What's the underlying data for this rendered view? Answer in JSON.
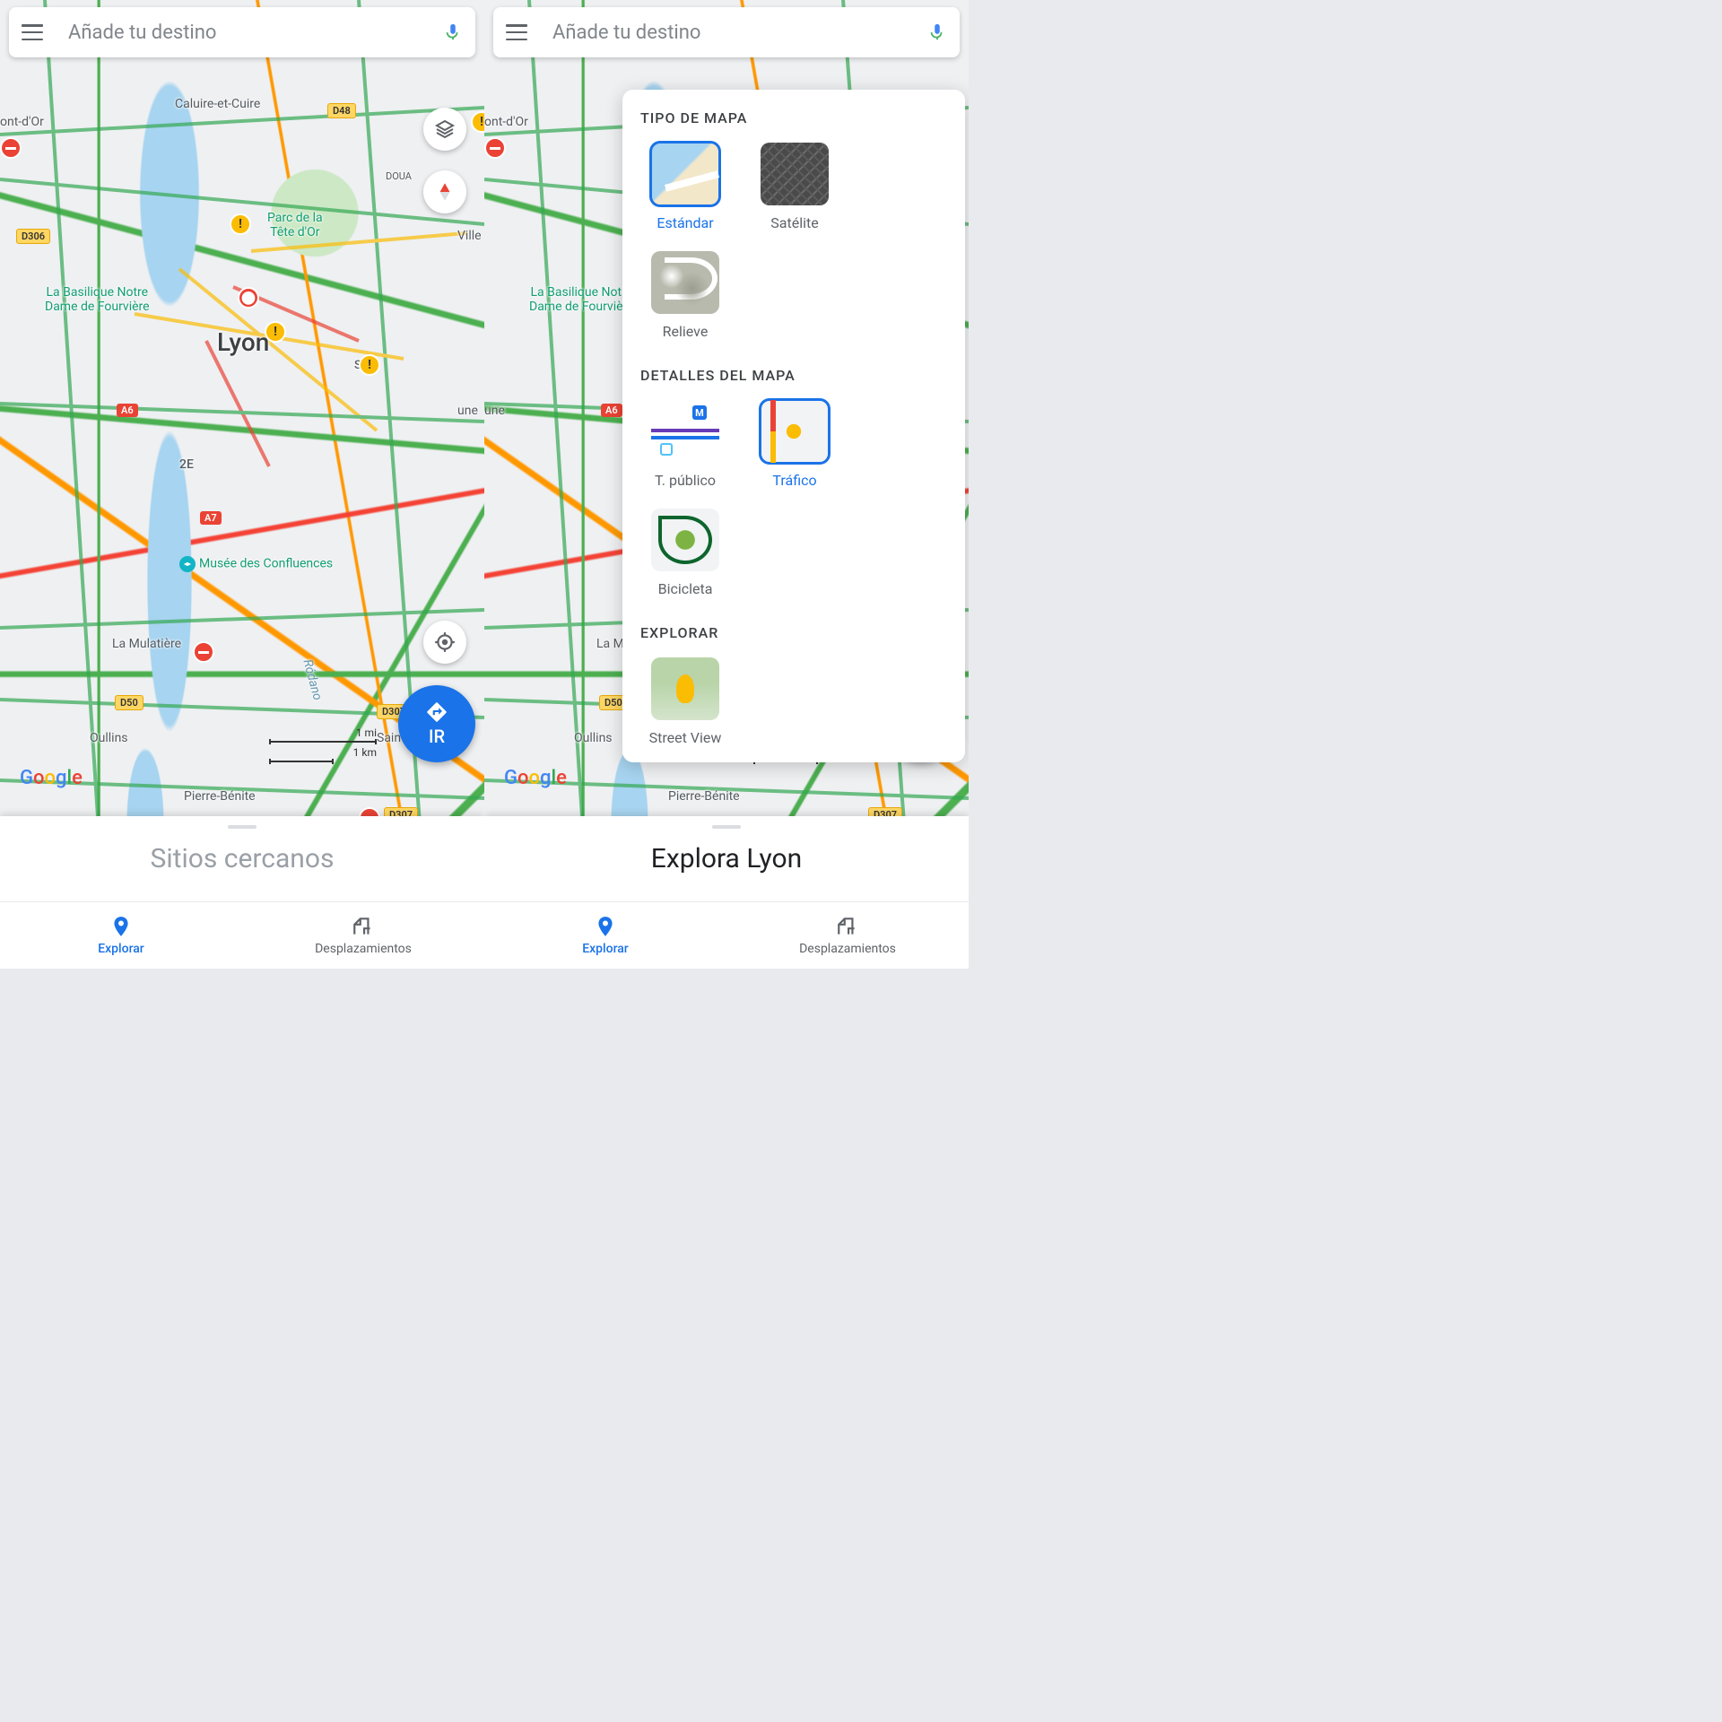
{
  "search": {
    "placeholder": "Añade tu destino"
  },
  "map": {
    "city": "Lyon",
    "places": {
      "caluire": "Caluire-et-Cuire",
      "ontdor": "ont-d'Or",
      "doua": "DOUA",
      "parctete": "Parc de la\nTête d'Or",
      "ville": "Ville",
      "basilique": "La Basilique Notre\nDame de Fourvière",
      "se": "SE",
      "une": "une",
      "e2": "2E",
      "confluences": "Musée des Confluences",
      "mulatiere": "La Mulatière",
      "oullins": "Oullins",
      "saintfo": "Saint-Fo",
      "pierrebenite": "Pierre-Bénite",
      "rodano": "Ródano"
    },
    "shields": {
      "d306": "D306",
      "d48": "D48",
      "a6": "A6",
      "a7": "A7",
      "d50": "D50",
      "d307": "D307"
    },
    "scale": {
      "mi": "1 mi",
      "km": "1 km"
    }
  },
  "go_button": "IR",
  "sheet": {
    "left_title": "Sitios cercanos",
    "right_title": "Explora Lyon"
  },
  "nav": {
    "explore": "Explorar",
    "commute": "Desplazamientos"
  },
  "layers_panel": {
    "map_type_title": "TIPO DE MAPA",
    "standard": "Estándar",
    "satellite": "Satélite",
    "terrain": "Relieve",
    "details_title": "DETALLES DEL MAPA",
    "transit": "T. público",
    "traffic": "Tráfico",
    "bike": "Bicicleta",
    "explore_title": "EXPLORAR",
    "streetview": "Street View"
  }
}
